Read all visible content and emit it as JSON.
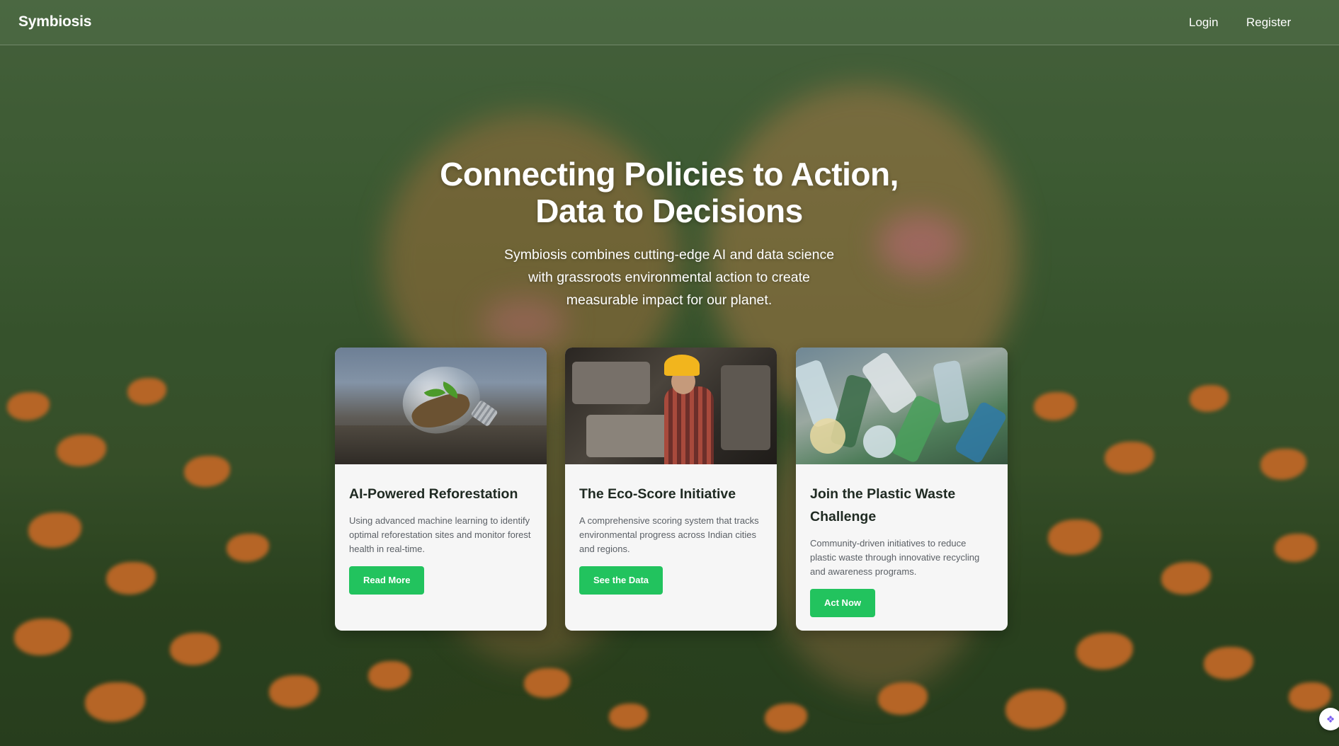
{
  "nav": {
    "brand": "Symbiosis",
    "login_label": "Login",
    "register_label": "Register"
  },
  "hero": {
    "title_line1": "Connecting Policies to Action,",
    "title_line2": "Data to Decisions",
    "subtitle": "Symbiosis combines cutting-edge AI and data science with grassroots environmental action to create measurable impact for our planet."
  },
  "cards": [
    {
      "image": "lightbulb-plant-photo",
      "title": "AI-Powered Reforestation",
      "text": "Using advanced machine learning to identify optimal reforestation sites and monitor forest health in real-time.",
      "button_label": "Read More"
    },
    {
      "image": "factory-worker-photo",
      "title": "The Eco-Score Initiative",
      "text": "A comprehensive scoring system that tracks environmental progress across Indian cities and regions.",
      "button_label": "See the Data"
    },
    {
      "image": "plastic-bottles-photo",
      "title": "Join the Plastic Waste Challenge",
      "text": "Community-driven initiatives to reduce plastic waste through innovative recycling and awareness programs.",
      "button_label": "Act Now"
    }
  ],
  "colors": {
    "accent": "#22c35e",
    "card_bg": "#f6f6f6",
    "title_text": "#1f2a22",
    "body_text": "#5b6066"
  },
  "background_image": "puppies-on-grass-with-orange-flowers"
}
